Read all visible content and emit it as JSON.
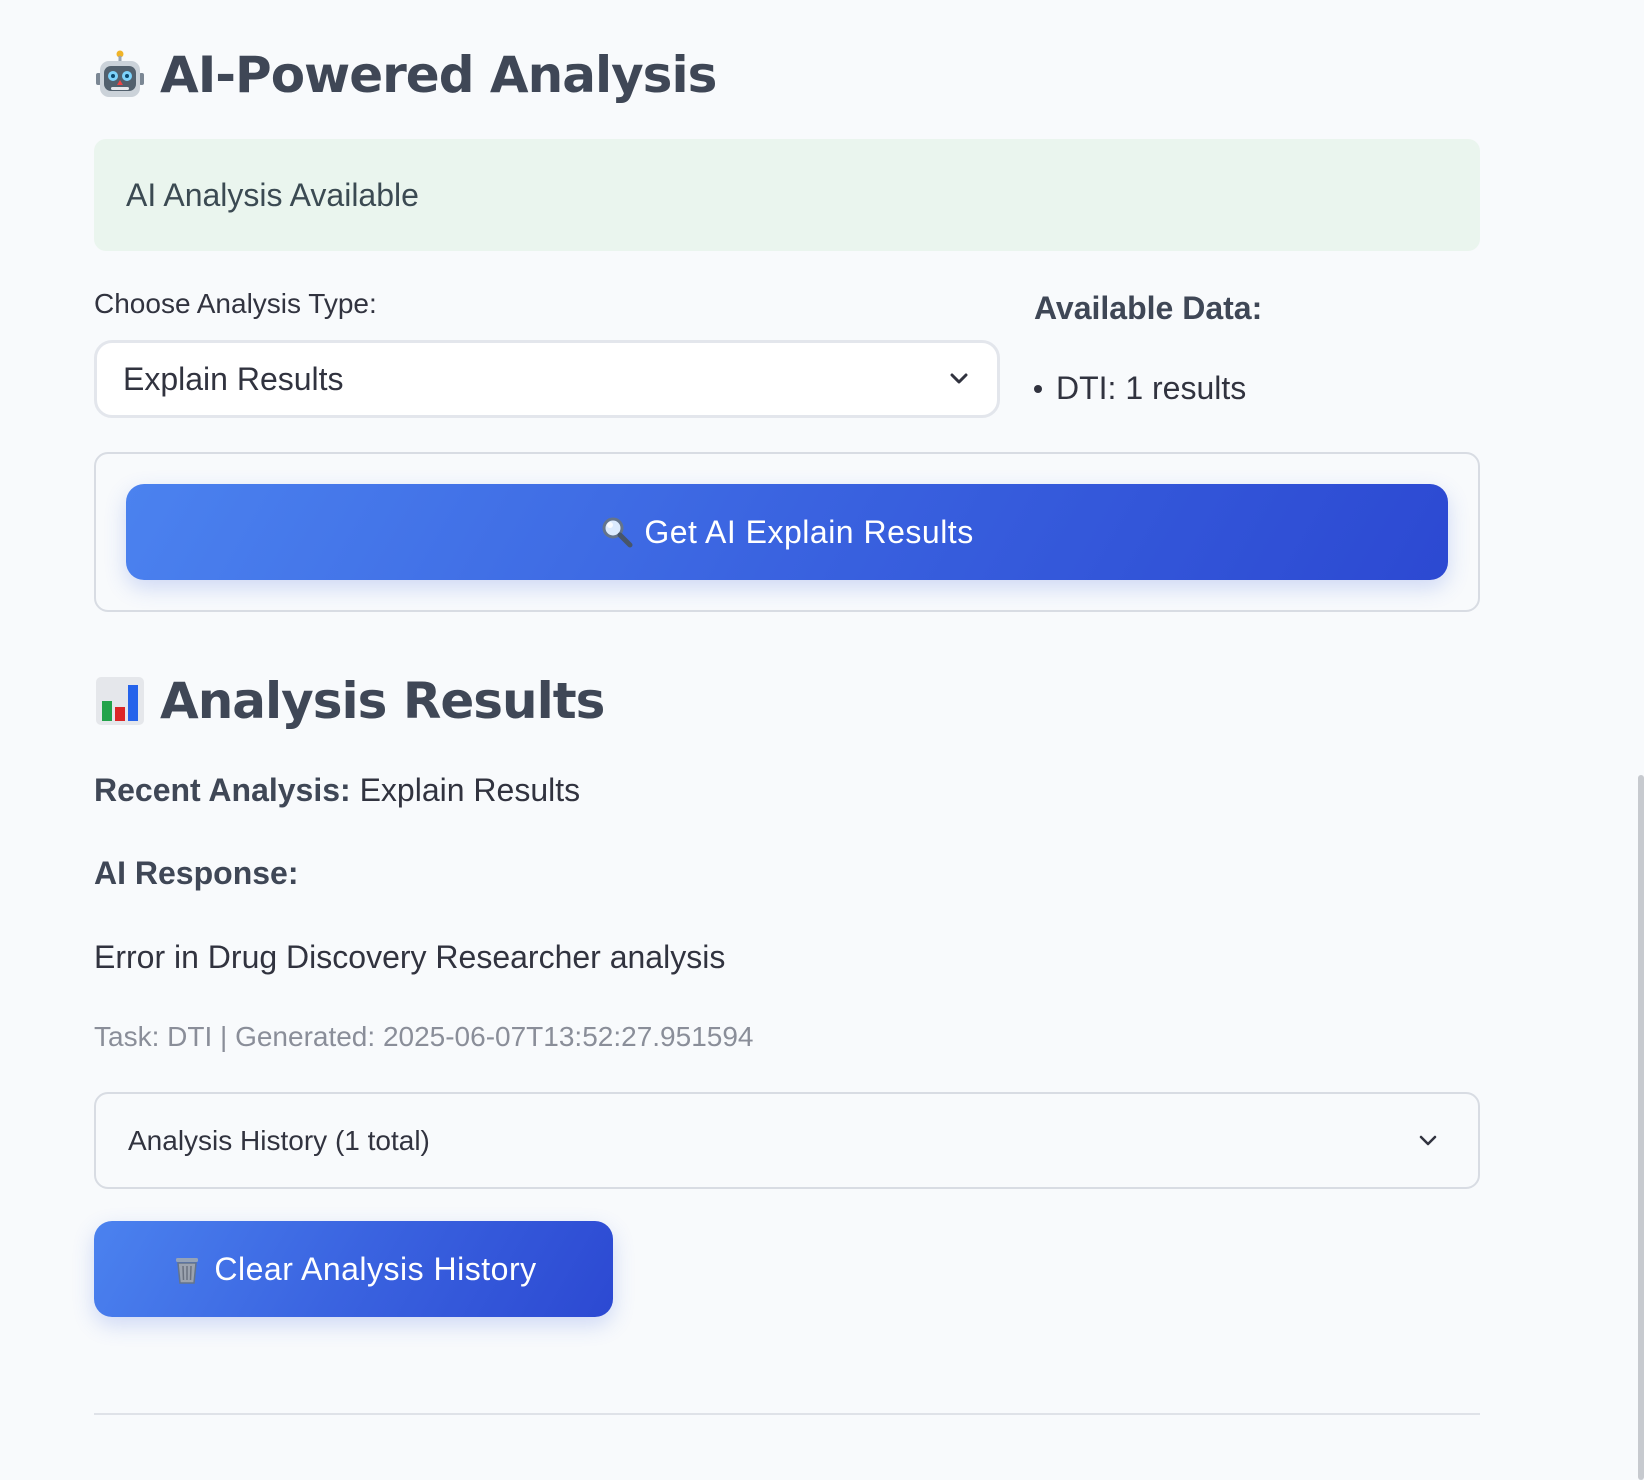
{
  "ai_section": {
    "title": "AI-Powered Analysis",
    "title_icon": "robot-icon",
    "status": "AI Analysis Available",
    "select_label": "Choose Analysis Type:",
    "select_value": "Explain Results",
    "available_heading": "Available Data:",
    "available_items": [
      "DTI: 1 results"
    ],
    "get_button_label": "Get AI Explain Results",
    "get_button_icon": "magnifier-icon"
  },
  "results_section": {
    "title": "Analysis Results",
    "title_icon": "bar-chart-icon",
    "recent_label": "Recent Analysis:",
    "recent_value": "Explain Results",
    "response_label": "AI Response:",
    "response_text": "Error in Drug Discovery Researcher analysis",
    "meta": "Task: DTI | Generated: 2025-06-07T13:52:27.951594",
    "history_label": "Analysis History (1 total)",
    "clear_button_label": "Clear Analysis History",
    "clear_button_icon": "trash-icon"
  },
  "colors": {
    "background": "#f8fafc",
    "status_bg": "#eaf5ee",
    "button_gradient_start": "#4b82ef",
    "button_gradient_end": "#2c49d2",
    "heading": "#3f4756",
    "muted_text": "#8a8e99"
  }
}
